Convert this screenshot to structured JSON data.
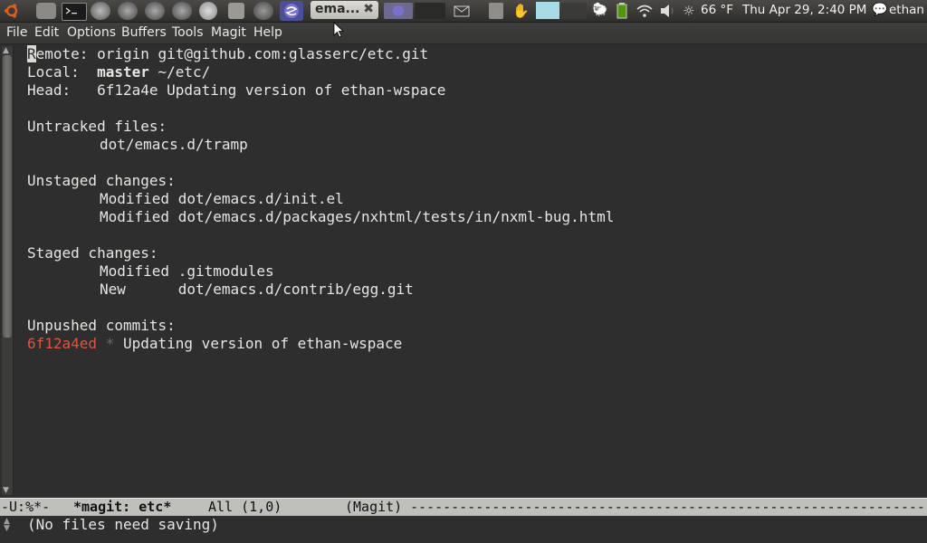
{
  "panel": {
    "active_task_label": "ema...",
    "temperature": "66 °F",
    "clock": "Thu Apr 29, 2:40 PM",
    "user": "ethan"
  },
  "menubar": {
    "items": [
      "File",
      "Edit",
      "Options",
      "Buffers",
      "Tools",
      "Magit",
      "Help"
    ]
  },
  "buffer": {
    "remote_label": "Remote:",
    "remote_value": "origin git@github.com:glasserc/etc.git",
    "remote_first_char": "R",
    "remote_rest": "emote:",
    "local_label": "Local:",
    "local_branch": "master",
    "local_path": "~/etc/",
    "head_label": "Head:",
    "head_value": "6f12a4e Updating version of ethan-wspace",
    "untracked_header": "Untracked files:",
    "untracked_files": [
      "dot/emacs.d/tramp"
    ],
    "unstaged_header": "Unstaged changes:",
    "unstaged_files": [
      "Modified dot/emacs.d/init.el",
      "Modified dot/emacs.d/packages/nxhtml/tests/in/nxml-bug.html"
    ],
    "staged_header": "Staged changes:",
    "staged_files": [
      "Modified .gitmodules",
      "New      dot/emacs.d/contrib/egg.git"
    ],
    "unpushed_header": "Unpushed commits:",
    "unpushed_commit_hash": "6f12a4ed",
    "unpushed_commit_marker": "*",
    "unpushed_commit_message": "Updating version of ethan-wspace"
  },
  "modeline": {
    "status": "-U:%*-",
    "buffer_name": "*magit: etc*",
    "position": "All (1,0)",
    "mode": "(Magit)"
  },
  "echo": {
    "message": "(No files need saving)"
  },
  "colors": {
    "commit_hash": "#e0553f",
    "background": "#2e2e2e",
    "foreground": "#e6e6e2"
  }
}
